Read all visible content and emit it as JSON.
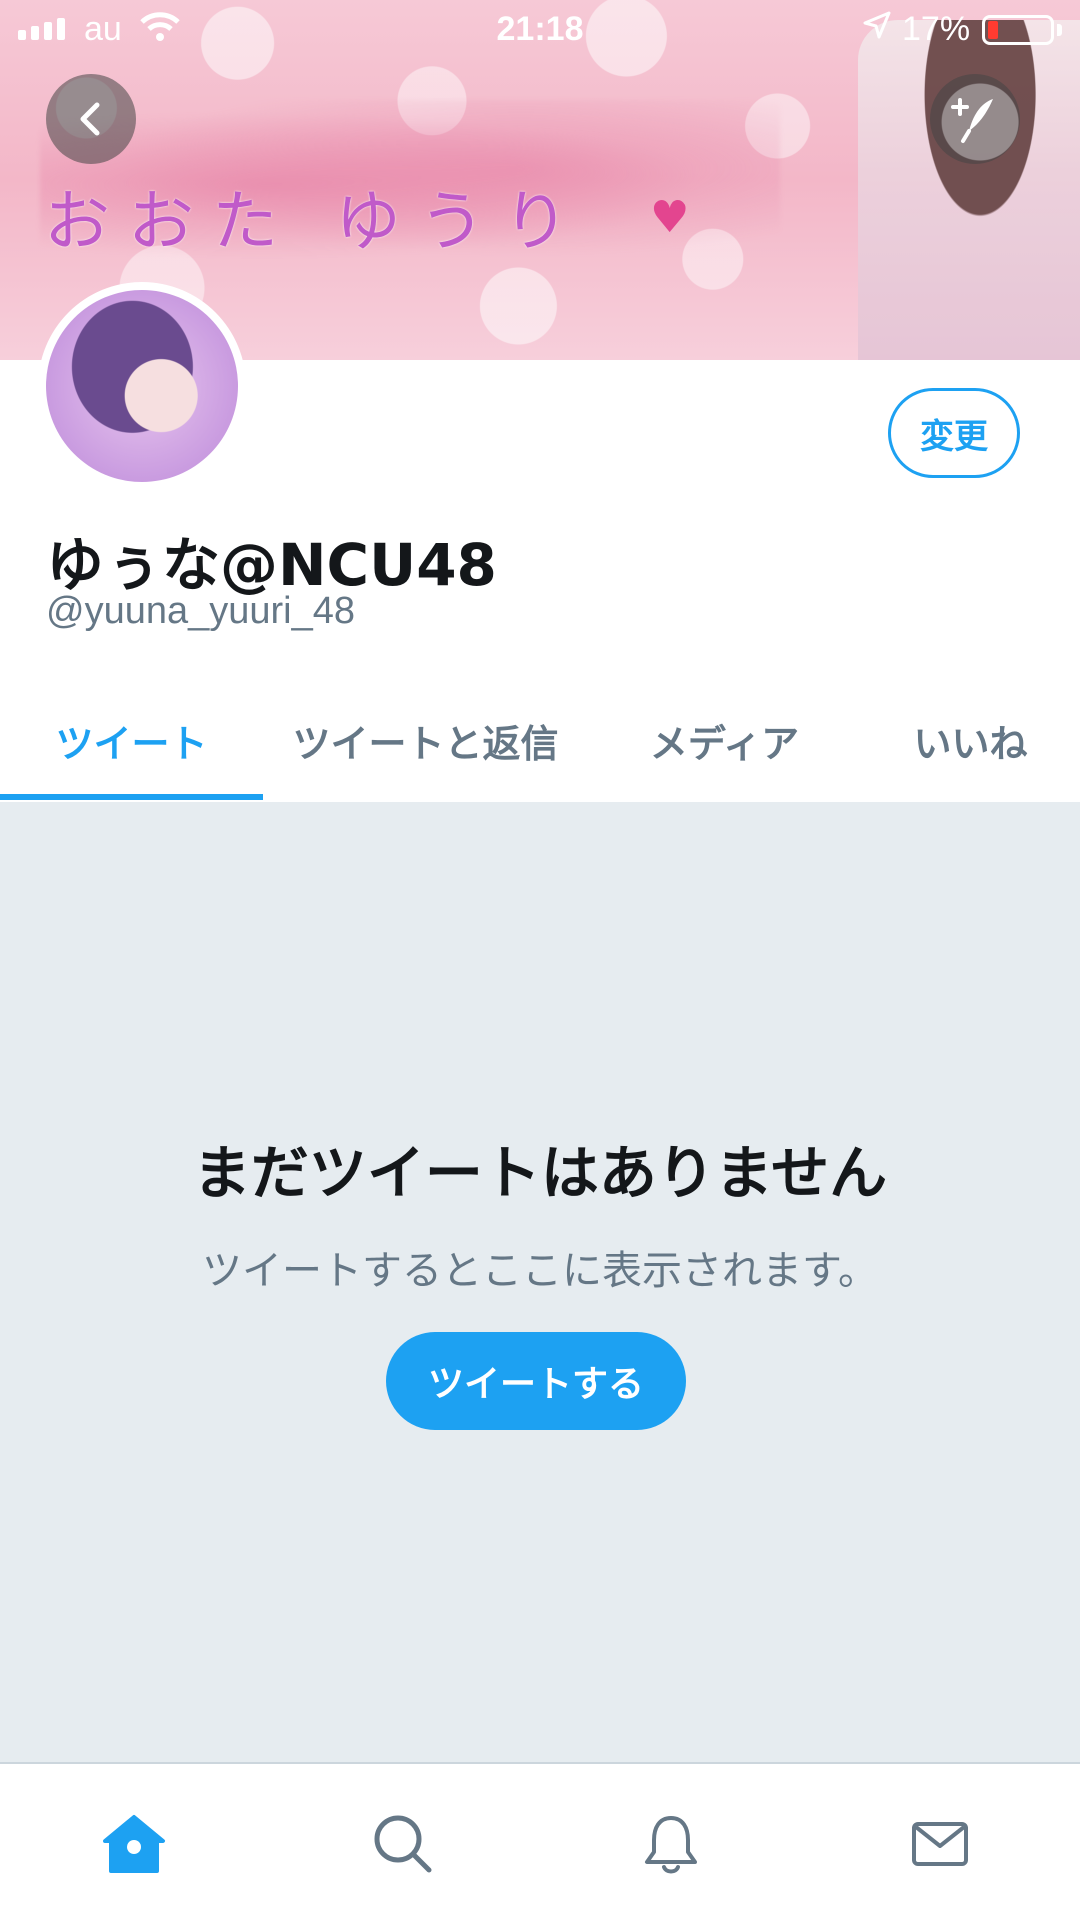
{
  "status_bar": {
    "carrier": "au",
    "time": "21:18",
    "battery_percent": "17%",
    "battery_level": 0.17,
    "icons": [
      "signal-icon",
      "wifi-icon",
      "location-arrow-icon",
      "battery-icon"
    ]
  },
  "header": {
    "banner_text": "おおた ゆうり",
    "back_icon": "chevron-left-icon",
    "compose_icon": "compose-tweet-icon"
  },
  "profile": {
    "display_name": "ゆぅな@NCU48",
    "handle": "@yuuna_yuuri_48",
    "edit_button_label": "変更"
  },
  "tabs": [
    {
      "label": "ツイート",
      "active": true
    },
    {
      "label": "ツイートと返信",
      "active": false
    },
    {
      "label": "メディア",
      "active": false
    },
    {
      "label": "いいね",
      "active": false
    }
  ],
  "empty_state": {
    "title": "まだツイートはありません",
    "subtitle": "ツイートするとここに表示されます。",
    "button_label": "ツイートする"
  },
  "bottom_nav": [
    {
      "icon": "home-icon",
      "active": true
    },
    {
      "icon": "search-icon",
      "active": false
    },
    {
      "icon": "notifications-bell-icon",
      "active": false
    },
    {
      "icon": "messages-envelope-icon",
      "active": false
    }
  ],
  "colors": {
    "accent": "#1da1f2",
    "text_primary": "#14171a",
    "text_secondary": "#657786",
    "empty_background": "#e6ecf0",
    "battery_low": "#ff3b30",
    "inactive_icon": "#657786"
  }
}
